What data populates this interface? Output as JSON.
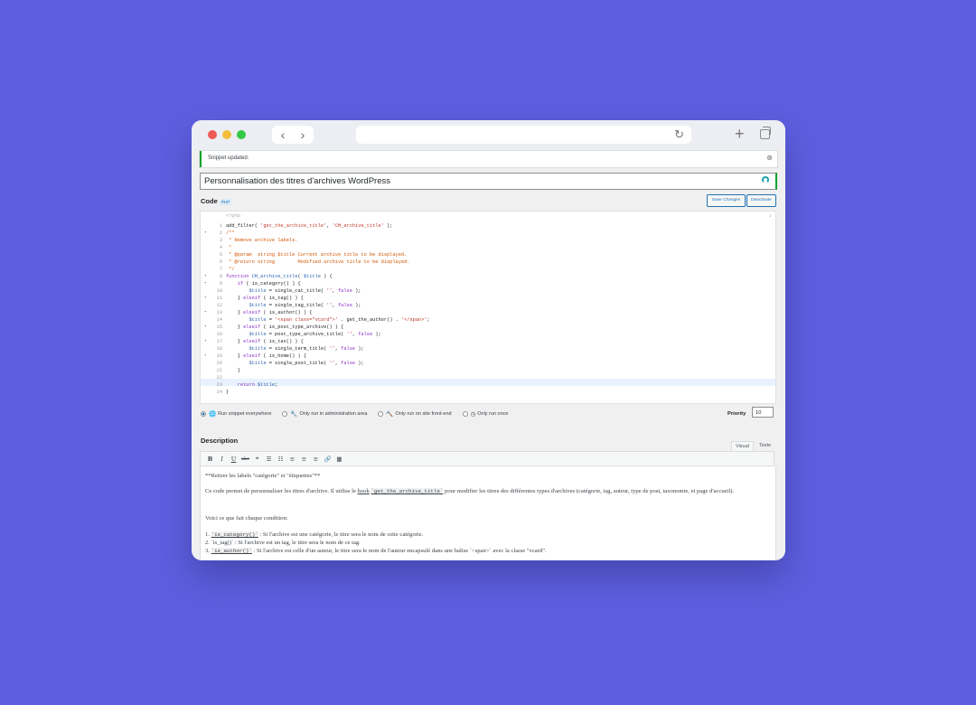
{
  "browser": {
    "reload_icon": "reload-icon",
    "new_tab_icon": "plus-icon",
    "tabs_icon": "tabs-overview-icon",
    "back_glyph": "‹",
    "forward_glyph": "›",
    "reload_glyph": "↻",
    "plus_glyph": "+"
  },
  "notice": {
    "text": "Snippet updated.",
    "close_glyph": "⊗"
  },
  "snippet": {
    "title": "Personnalisation des titres d'archives WordPress"
  },
  "code_section": {
    "heading": "Code",
    "badge": "PHP",
    "save_label": "Save Changes",
    "deactivate_label": "Deactivate",
    "open_tag": "<?php",
    "line_numbers": [
      "1",
      "2",
      "3",
      "4",
      "5",
      "6",
      "7",
      "8",
      "9",
      "10",
      "11",
      "12",
      "13",
      "14",
      "15",
      "16",
      "17",
      "18",
      "19",
      "20",
      "21",
      "22",
      "23",
      "24"
    ]
  },
  "scope": {
    "options": [
      {
        "label": "Run snippet everywhere",
        "icon": "globe-icon",
        "glyph": "🌐",
        "selected": true
      },
      {
        "label": "Only run in administration area",
        "icon": "wrench-icon",
        "glyph": "🔧",
        "selected": false
      },
      {
        "label": "Only run on site front-end",
        "icon": "hammer-icon",
        "glyph": "🔨",
        "selected": false
      },
      {
        "label": "Only run once",
        "icon": "clock-icon",
        "glyph": "◷",
        "selected": false
      }
    ],
    "priority_label": "Priority",
    "priority_value": "10"
  },
  "description": {
    "heading": "Description",
    "tab_visual": "Visual",
    "tab_text": "Texte",
    "toolbar": [
      "B",
      "I",
      "U",
      "abc",
      "❝",
      "☰",
      "☷",
      "≡",
      "≡",
      "≡",
      "🔗",
      "▦"
    ],
    "toolbar_icons": [
      "bold-icon",
      "italic-icon",
      "underline-icon",
      "strikethrough-icon",
      "quote-icon",
      "bullet-list-icon",
      "numbered-list-icon",
      "align-left-icon",
      "align-center-icon",
      "align-right-icon",
      "link-icon",
      "table-icon"
    ],
    "para1": "**Retirer les labels \"catégorie\" et \"étiquettes\"**",
    "para2_a": "Ce code permet de personnaliser les titres d'archive. Il utilise le ",
    "para2_hook": "hook",
    "para2_code": "`get_the_archive_title`",
    "para2_b": " pour modifier les titres des différentes types d'archives (catégorie, tag, auteur, type de post, taxonomie, et page d'accueil).",
    "para3": "Voici ce que fait chaque condition:",
    "li1_code": "`is_category()`",
    "li1_text": " : Si l'archive est une catégorie, le titre sera le nom de cette catégorie.",
    "li2_text": "`is_tag()` : Si l'archive est un tag, le titre sera le nom de ce tag.",
    "li3_code": "`is_author()`",
    "li3_text": " : Si l'archive est celle d'un auteur, le titre sera le nom de l'auteur encapsulé dans une balise `<span>` avec la classe \"vcard\"."
  }
}
